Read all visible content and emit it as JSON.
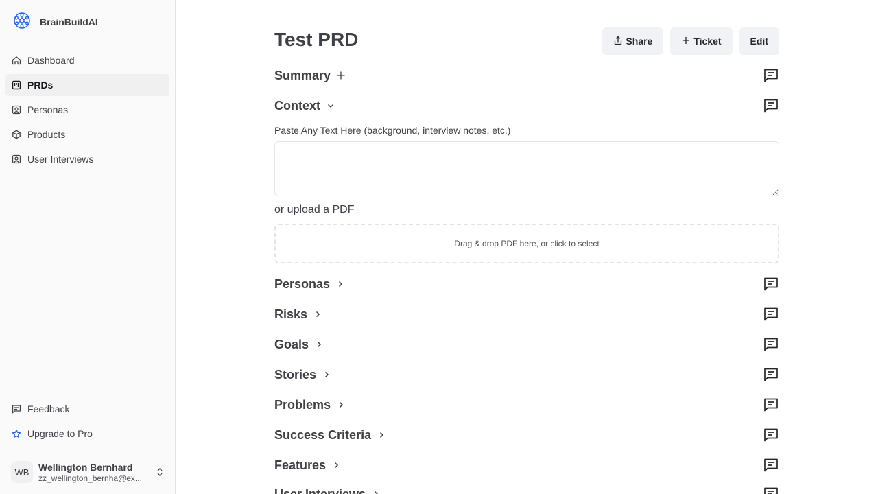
{
  "app": {
    "name": "BrainBuildAI"
  },
  "sidebar": {
    "items": [
      {
        "label": "Dashboard",
        "icon": "home-icon"
      },
      {
        "label": "PRDs",
        "icon": "kanban-icon",
        "active": true
      },
      {
        "label": "Personas",
        "icon": "user-square-icon"
      },
      {
        "label": "Products",
        "icon": "box-icon"
      },
      {
        "label": "User Interviews",
        "icon": "user-square-icon"
      }
    ],
    "bottom": [
      {
        "label": "Feedback",
        "icon": "message-square-icon"
      },
      {
        "label": "Upgrade to Pro",
        "icon": "star-icon"
      }
    ],
    "user": {
      "initials": "WB",
      "name": "Wellington Bernhard",
      "email": "zz_wellington_bernha@ex..."
    }
  },
  "page": {
    "title": "Test PRD",
    "actions": {
      "share": "Share",
      "ticket": "Ticket",
      "edit": "Edit"
    },
    "context": {
      "label": "Paste Any Text Here (background, interview notes, etc.)",
      "value": "",
      "upload_label": "or upload a PDF",
      "dropzone": "Drag & drop PDF here, or click to select"
    },
    "sections": [
      "Summary",
      "Context",
      "Personas",
      "Risks",
      "Goals",
      "Stories",
      "Problems",
      "Success Criteria",
      "Features",
      "User Interviews"
    ]
  },
  "colors": {
    "accent": "#2563eb",
    "button_bg": "#f1f2f5",
    "sidebar_bg": "#fafafa"
  }
}
